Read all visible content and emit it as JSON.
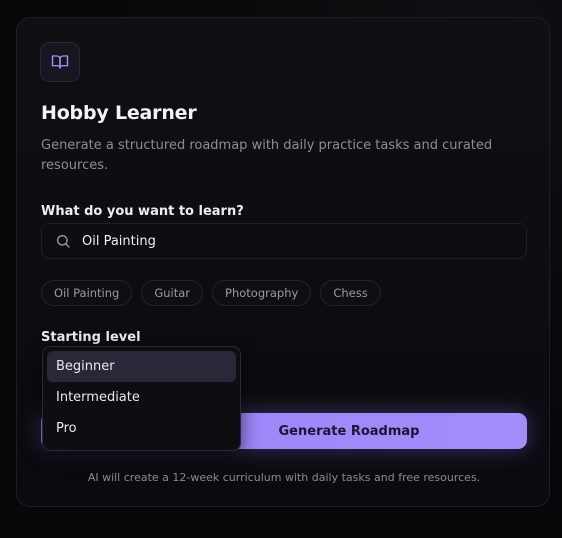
{
  "app": {
    "title": "Hobby Learner",
    "subtitle": "Generate a structured roadmap with daily practice tasks and curated resources.",
    "logo_icon": "open-book-icon",
    "accent_color": "#a48cfb"
  },
  "search": {
    "label": "What do you want to learn?",
    "value": "Oil Painting",
    "placeholder": "",
    "icon": "search-icon"
  },
  "suggestions": [
    "Oil Painting",
    "Guitar",
    "Photography",
    "Chess"
  ],
  "level": {
    "label": "Starting level",
    "options": [
      "Beginner",
      "Intermediate",
      "Pro"
    ],
    "highlighted": "Beginner"
  },
  "generate": {
    "label": "Generate Roadmap"
  },
  "footnote": "AI will create a 12-week curriculum with daily tasks and free resources."
}
